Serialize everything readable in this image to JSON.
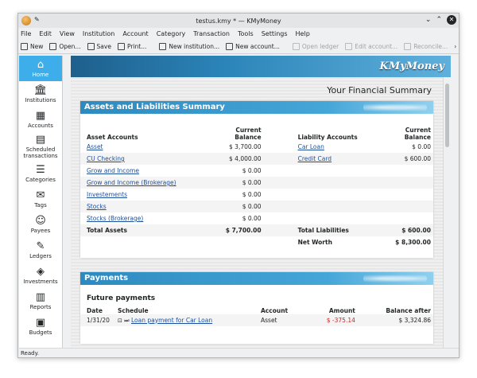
{
  "window": {
    "title": "testus.kmy * — KMyMoney"
  },
  "menu": [
    "File",
    "Edit",
    "View",
    "Institution",
    "Account",
    "Category",
    "Transaction",
    "Tools",
    "Settings",
    "Help"
  ],
  "toolbar": {
    "new": "New",
    "open": "Open...",
    "save": "Save",
    "print": "Print...",
    "new_institution": "New institution...",
    "new_account": "New account...",
    "open_ledger": "Open ledger",
    "edit_account": "Edit account...",
    "reconcile": "Reconcile..."
  },
  "sidebar": [
    {
      "label": "Home",
      "icon": "home-icon"
    },
    {
      "label": "Institutions",
      "icon": "bank-icon"
    },
    {
      "label": "Accounts",
      "icon": "accounts-icon"
    },
    {
      "label": "Scheduled transactions",
      "icon": "calendar-icon"
    },
    {
      "label": "Categories",
      "icon": "categories-icon"
    },
    {
      "label": "Tags",
      "icon": "tag-icon"
    },
    {
      "label": "Payees",
      "icon": "payees-icon"
    },
    {
      "label": "Ledgers",
      "icon": "ledger-icon"
    },
    {
      "label": "Investments",
      "icon": "investment-icon"
    },
    {
      "label": "Reports",
      "icon": "report-icon"
    },
    {
      "label": "Budgets",
      "icon": "budget-icon"
    }
  ],
  "logo": "KMyMoney",
  "page_title": "Your Financial Summary",
  "summary": {
    "title": "Assets and Liabilities Summary",
    "asset_header": "Asset Accounts",
    "balance_header": "Current Balance",
    "liability_header": "Liability Accounts",
    "assets": [
      {
        "name": "Asset",
        "balance": "$ 3,700.00"
      },
      {
        "name": "CU Checking",
        "balance": "$ 4,000.00"
      },
      {
        "name": "Grow and Income",
        "balance": "$ 0.00"
      },
      {
        "name": "Grow and Income (Brokerage)",
        "balance": "$ 0.00"
      },
      {
        "name": "Investements",
        "balance": "$ 0.00"
      },
      {
        "name": "Stocks",
        "balance": "$ 0.00"
      },
      {
        "name": "Stocks (Brokerage)",
        "balance": "$ 0.00"
      }
    ],
    "liabilities": [
      {
        "name": "Car Loan",
        "balance": "$ 0.00"
      },
      {
        "name": "Credit Card",
        "balance": "$ 600.00"
      }
    ],
    "total_assets_label": "Total Assets",
    "total_assets": "$ 7,700.00",
    "total_liabilities_label": "Total Liabilities",
    "total_liabilities": "$ 600.00",
    "net_worth_label": "Net Worth",
    "net_worth": "$ 8,300.00"
  },
  "payments": {
    "title": "Payments",
    "subtitle": "Future payments",
    "headers": {
      "date": "Date",
      "schedule": "Schedule",
      "account": "Account",
      "amount": "Amount",
      "balance_after": "Balance after"
    },
    "rows": [
      {
        "date": "1/31/20",
        "schedule": "Loan payment for Car Loan",
        "account": "Asset",
        "amount": "$ -375.14",
        "balance_after": "$ 3,324.86"
      }
    ]
  },
  "status": "Ready."
}
